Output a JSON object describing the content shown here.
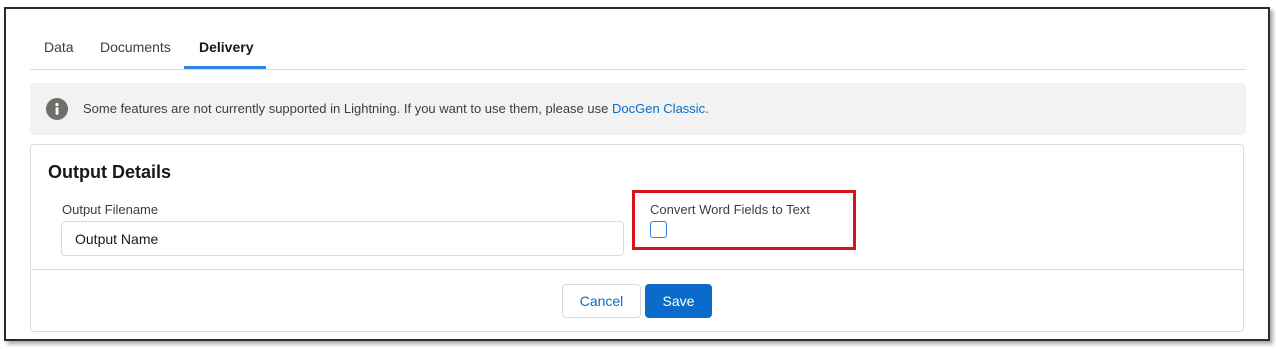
{
  "tabs": [
    {
      "label": "Data",
      "active": false
    },
    {
      "label": "Documents",
      "active": false
    },
    {
      "label": "Delivery",
      "active": true
    }
  ],
  "notice": {
    "icon": "info-icon",
    "text": "Some features are not currently supported in Lightning. If you want to use them, please use ",
    "link": "DocGen Classic."
  },
  "card": {
    "title": "Output Details",
    "output_filename": {
      "label": "Output Filename",
      "value": "Output Name"
    },
    "convert_word_fields": {
      "label": "Convert Word Fields to Text",
      "checked": false
    }
  },
  "actions": {
    "cancel_label": "Cancel",
    "save_label": "Save"
  },
  "colors": {
    "accent": "#0b6bcb",
    "tab_underline": "#2e84e0",
    "highlight": "#d9121c"
  }
}
